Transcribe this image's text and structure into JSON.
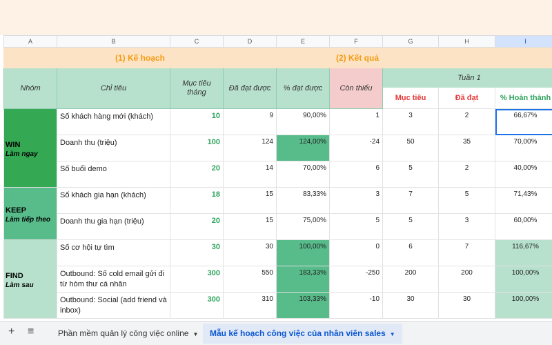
{
  "columns": [
    "A",
    "B",
    "C",
    "D",
    "E",
    "F",
    "G",
    "H",
    "I"
  ],
  "sections": {
    "plan": "(1) Kế hoạch",
    "result": "(2) Kết quả"
  },
  "headers": {
    "group": "Nhóm",
    "indicator": "Chỉ tiêu",
    "monthly_target": "Mục tiêu tháng",
    "achieved": "Đã đạt được",
    "pct_achieved": "% đạt được",
    "remaining": "Còn thiếu",
    "week": "Tuần 1",
    "w_target": "Mục tiêu",
    "w_done": "Đã đạt",
    "w_pct": "% Hoàn thành"
  },
  "groups": [
    {
      "name": "WIN",
      "sub": "Làm ngay"
    },
    {
      "name": "KEEP",
      "sub": "Làm tiếp theo"
    },
    {
      "name": "FIND",
      "sub": "Làm sau"
    }
  ],
  "rows": [
    {
      "indicator": "Số khách hàng mới (khách)",
      "target": "10",
      "achieved": "9",
      "pct": "90,00%",
      "remaining": "1",
      "w_target": "3",
      "w_done": "2",
      "w_pct": "66,67%"
    },
    {
      "indicator": "Doanh thu (triệu)",
      "target": "100",
      "achieved": "124",
      "pct": "124,00%",
      "remaining": "-24",
      "w_target": "50",
      "w_done": "35",
      "w_pct": "70,00%"
    },
    {
      "indicator": "Số buổi demo",
      "target": "20",
      "achieved": "14",
      "pct": "70,00%",
      "remaining": "6",
      "w_target": "5",
      "w_done": "2",
      "w_pct": "40,00%"
    },
    {
      "indicator": "Số khách gia hạn (khách)",
      "target": "18",
      "achieved": "15",
      "pct": "83,33%",
      "remaining": "3",
      "w_target": "7",
      "w_done": "5",
      "w_pct": "71,43%"
    },
    {
      "indicator": "Doanh thu gia hạn (triệu)",
      "target": "20",
      "achieved": "15",
      "pct": "75,00%",
      "remaining": "5",
      "w_target": "5",
      "w_done": "3",
      "w_pct": "60,00%"
    },
    {
      "indicator": "Số cơ hội tự tìm",
      "target": "30",
      "achieved": "30",
      "pct": "100,00%",
      "remaining": "0",
      "w_target": "6",
      "w_done": "7",
      "w_pct": "116,67%"
    },
    {
      "indicator": "Outbound: Số cold email gửi đi từ hòm thư cá nhân",
      "target": "300",
      "achieved": "550",
      "pct": "183,33%",
      "remaining": "-250",
      "w_target": "200",
      "w_done": "200",
      "w_pct": "100,00%"
    },
    {
      "indicator": "Outbound: Social (add friend và inbox)",
      "target": "300",
      "achieved": "310",
      "pct": "103,33%",
      "remaining": "-10",
      "w_target": "30",
      "w_done": "30",
      "w_pct": "100,00%"
    }
  ],
  "tabs": {
    "add": "+",
    "menu": "≡",
    "sheet1": "Phần mềm quản lý công việc online",
    "sheet2": "Mẫu kế hoạch công việc của nhân viên sales"
  },
  "colors": {
    "dark_green": "#34a853",
    "mid_green": "#57bb8a",
    "light_green": "#b7e1cd",
    "header_orange": "#f39c12",
    "pink": "#f4cccc"
  }
}
